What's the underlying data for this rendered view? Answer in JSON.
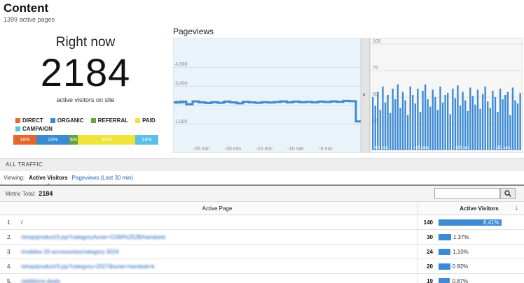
{
  "header": {
    "title": "Content",
    "subtitle": "1399 active pages"
  },
  "right_now": {
    "label": "Right now",
    "count": "2184",
    "caption": "active visitors on site"
  },
  "legend": {
    "items": [
      {
        "label": "DIRECT",
        "color": "#e4672e"
      },
      {
        "label": "ORGANIC",
        "color": "#3b8bd0"
      },
      {
        "label": "REFERRAL",
        "color": "#6aa33b"
      },
      {
        "label": "PAID",
        "color": "#f0e43a"
      },
      {
        "label": "CAMPAIGN",
        "color": "#5cc0e6"
      }
    ]
  },
  "source_bar": [
    {
      "label": "16%",
      "value": 16,
      "color": "#e4672e"
    },
    {
      "label": "23%",
      "value": 23,
      "color": "#3b8bd0"
    },
    {
      "label": "6%",
      "value": 6,
      "color": "#6aa33b"
    },
    {
      "label": "40%",
      "value": 40,
      "color": "#f0e43a"
    },
    {
      "label": "16%",
      "value": 16,
      "color": "#5cc0e6"
    }
  ],
  "pageviews": {
    "title": "Pageviews",
    "y_ticks": [
      "4,000",
      "3,000",
      "2,000",
      "1,000"
    ],
    "x_ticks": [
      "-25 min",
      "-20 min",
      "-15 min",
      "-10 min",
      "-5 min"
    ],
    "bar_y_ticks": [
      "100",
      "75",
      "50",
      "25"
    ],
    "bar_x_ticks": [
      "-60 sec",
      "-45 sec",
      "-30 sec",
      "-15 sec"
    ]
  },
  "chart_data": [
    {
      "type": "line",
      "title": "Pageviews",
      "x": [
        -29,
        -28,
        -27,
        -26,
        -25,
        -24,
        -23,
        -22,
        -21,
        -20,
        -19,
        -18,
        -17,
        -16,
        -15,
        -14,
        -13,
        -12,
        -11,
        -10,
        -9,
        -8,
        -7,
        -6,
        -5,
        -4,
        -3,
        -2,
        -1,
        0
      ],
      "values": [
        2150,
        2180,
        2050,
        2200,
        2150,
        2120,
        2160,
        2130,
        2190,
        2150,
        2100,
        2180,
        2150,
        2130,
        2160,
        2140,
        2170,
        2200,
        2150,
        2190,
        2160,
        2180,
        2150,
        2190,
        2170,
        2200,
        2180,
        2230,
        2210,
        1150
      ],
      "ylim": [
        0,
        5000
      ]
    },
    {
      "type": "bar",
      "values": [
        50,
        42,
        55,
        38,
        60,
        45,
        52,
        35,
        58,
        48,
        62,
        40,
        55,
        47,
        33,
        60,
        52,
        44,
        58,
        36,
        56,
        62,
        48,
        41,
        57,
        50,
        38,
        60,
        45,
        52,
        54,
        34,
        58,
        49,
        61,
        42,
        55,
        47,
        37,
        59,
        51,
        43,
        57,
        39,
        53,
        60,
        46,
        40,
        56,
        50,
        36,
        58,
        48,
        52,
        55,
        33,
        59,
        47,
        44,
        54
      ],
      "ylim": [
        0,
        100
      ]
    }
  ],
  "traffic_label": "ALL TRAFFIC",
  "viewing": {
    "label": "Viewing:",
    "active": "Active Visitors",
    "other": "Pageviews (Last 30 min)"
  },
  "table": {
    "metric_label": "Metric Total:",
    "metric_value": "2184",
    "search_icon": "search-icon",
    "col_page": "Active Page",
    "col_visitors": "Active Visitors",
    "rows": [
      {
        "idx": "1.",
        "page": "/",
        "count": "140",
        "pct": "6.41%",
        "value": 6.41
      },
      {
        "idx": "2.",
        "page": "/shop/product/3.jsp?category/tuner=GSM%252B/handsets",
        "count": "30",
        "pct": "1.37%",
        "value": 1.37
      },
      {
        "idx": "3.",
        "page": "/mobiles-20-accessories/category-3024",
        "count": "24",
        "pct": "1.10%",
        "value": 1.1
      },
      {
        "idx": "4.",
        "page": "/shop/product/3.jsp?category=2027&tuner=handset=k",
        "count": "20",
        "pct": "0.92%",
        "value": 0.92
      },
      {
        "idx": "5.",
        "page": "/additions-deals",
        "count": "19",
        "pct": "0.87%",
        "value": 0.87
      }
    ]
  }
}
